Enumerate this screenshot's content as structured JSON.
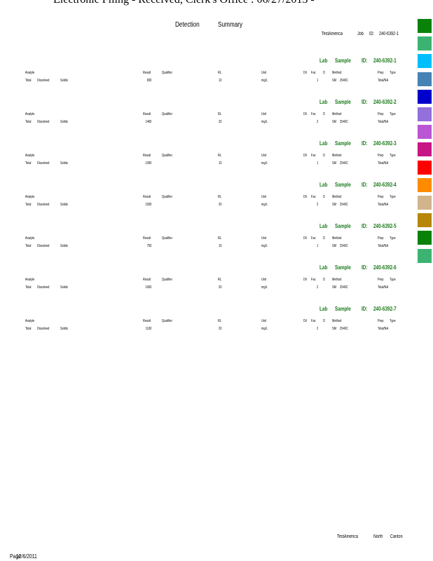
{
  "header": {
    "top_text": "Electronic Filing - Received, Clerk's Office : 06/27/2013 -"
  },
  "title": {
    "word1": "Detection",
    "word2": "Summary"
  },
  "job": {
    "lab_name": "TestAmerica",
    "job_label": "Job",
    "id_label": "ID:",
    "job_id": "240-6392-1"
  },
  "col_labels": {
    "analyte": "Analyte",
    "result": "Result",
    "qualifier": "Qualifier",
    "rl": "RL",
    "unit": "Unit",
    "dil": "Dil",
    "fac": "Fac",
    "d": "D",
    "method": "Method",
    "prep": "Prep",
    "type": "Type"
  },
  "sample_labels": {
    "lab": "Lab",
    "sample": "Sample",
    "id": "ID:"
  },
  "samples": [
    {
      "sample_id": "240-6392-1",
      "analyte": [
        "Total",
        "Dissolved",
        "Solids"
      ],
      "result": "830",
      "rl": "10",
      "unit": "mg/L",
      "dil_fac": "1",
      "method": [
        "SM",
        "2540C"
      ],
      "prep_type": "Total/NA"
    },
    {
      "sample_id": "240-6392-2",
      "analyte": [
        "Total",
        "Dissolved",
        "Solids"
      ],
      "result": "1400",
      "rl": "20",
      "unit": "mg/L",
      "dil_fac": "2",
      "method": [
        "SM",
        "2540C"
      ],
      "prep_type": "Total/NA"
    },
    {
      "sample_id": "240-6392-3",
      "analyte": [
        "Total",
        "Dissolved",
        "Solids"
      ],
      "result": "1000",
      "rl": "10",
      "unit": "mg/L",
      "dil_fac": "1",
      "method": [
        "SM",
        "2540C"
      ],
      "prep_type": "Total/NA"
    },
    {
      "sample_id": "240-6392-4",
      "analyte": [
        "Total",
        "Dissolved",
        "Solids"
      ],
      "result": "1500",
      "rl": "20",
      "unit": "mg/L",
      "dil_fac": "2",
      "method": [
        "SM",
        "2540C"
      ],
      "prep_type": "Total/NA"
    },
    {
      "sample_id": "240-6392-5",
      "analyte": [
        "Total",
        "Dissolved",
        "Solids"
      ],
      "result": "750",
      "rl": "10",
      "unit": "mg/L",
      "dil_fac": "1",
      "method": [
        "SM",
        "2540C"
      ],
      "prep_type": "Total/NA"
    },
    {
      "sample_id": "240-6392-6",
      "analyte": [
        "Total",
        "Dissolved",
        "Solids"
      ],
      "result": "1600",
      "rl": "20",
      "unit": "mg/L",
      "dil_fac": "2",
      "method": [
        "SM",
        "2540C"
      ],
      "prep_type": "Total/NA"
    },
    {
      "sample_id": "240-6392-7",
      "analyte": [
        "Total",
        "Dissolved",
        "Solids"
      ],
      "result": "1100",
      "rl": "20",
      "unit": "mg/L",
      "dil_fac": "2",
      "method": [
        "SM",
        "2540C"
      ],
      "prep_type": "Total/NA"
    }
  ],
  "footer": {
    "right": [
      "TestAmerica",
      "North",
      "Canton"
    ],
    "page_label": "Page",
    "date": "12/6/2011"
  },
  "swatches": [
    "#0a820a",
    "#3cb371",
    "#00bfff",
    "#4682b4",
    "#0000cd",
    "#9370db",
    "#ba55d3",
    "#c71585",
    "#ff0000",
    "#ff8c00",
    "#d2b48c",
    "#b8860b",
    "#0a820a",
    "#3cb371"
  ]
}
